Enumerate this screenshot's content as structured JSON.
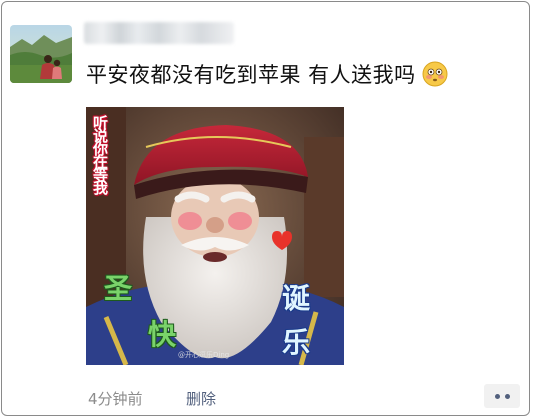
{
  "post": {
    "avatar_icon": "profile-photo-landscape",
    "author_name": "",
    "caption": "平安夜都没有吃到苹果 有人送我吗",
    "caption_emoji": "flushed-face-emoji",
    "image": {
      "description_icon": "santa-claus-meme",
      "overlay_left": "听说你在等我",
      "overlay_sheng": "圣",
      "overlay_kuai": "快",
      "overlay_dan": "诞",
      "overlay_le": "乐",
      "watermark": "@开心逗乐Ding"
    }
  },
  "footer": {
    "timestamp": "4分钟前",
    "delete_label": "删除",
    "more_icon": "more-dots-icon"
  },
  "colors": {
    "link": "#52607d",
    "muted": "#8c8c8c",
    "text": "#111111"
  }
}
